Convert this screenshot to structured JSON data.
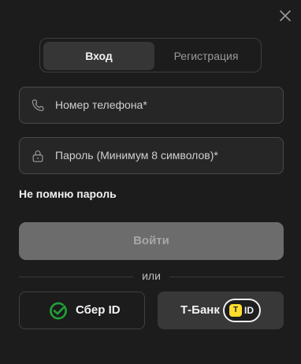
{
  "tabs": {
    "login": "Вход",
    "register": "Регистрация"
  },
  "fields": {
    "phone_placeholder": "Номер телефона*",
    "password_placeholder": "Пароль (Минимум 8 символов)*"
  },
  "forgot_password": "Не помню пароль",
  "login_button": "Войти",
  "divider_text": "или",
  "sber": {
    "label": "Сбер ID",
    "icon": "sber-check-icon",
    "color": "#21a038"
  },
  "tbank": {
    "label": "Т-Банк",
    "badge": "T",
    "id_text": "ID",
    "badge_color": "#ffdd2d"
  },
  "icons": {
    "close": "close-icon",
    "phone": "phone-icon",
    "lock": "lock-icon"
  }
}
